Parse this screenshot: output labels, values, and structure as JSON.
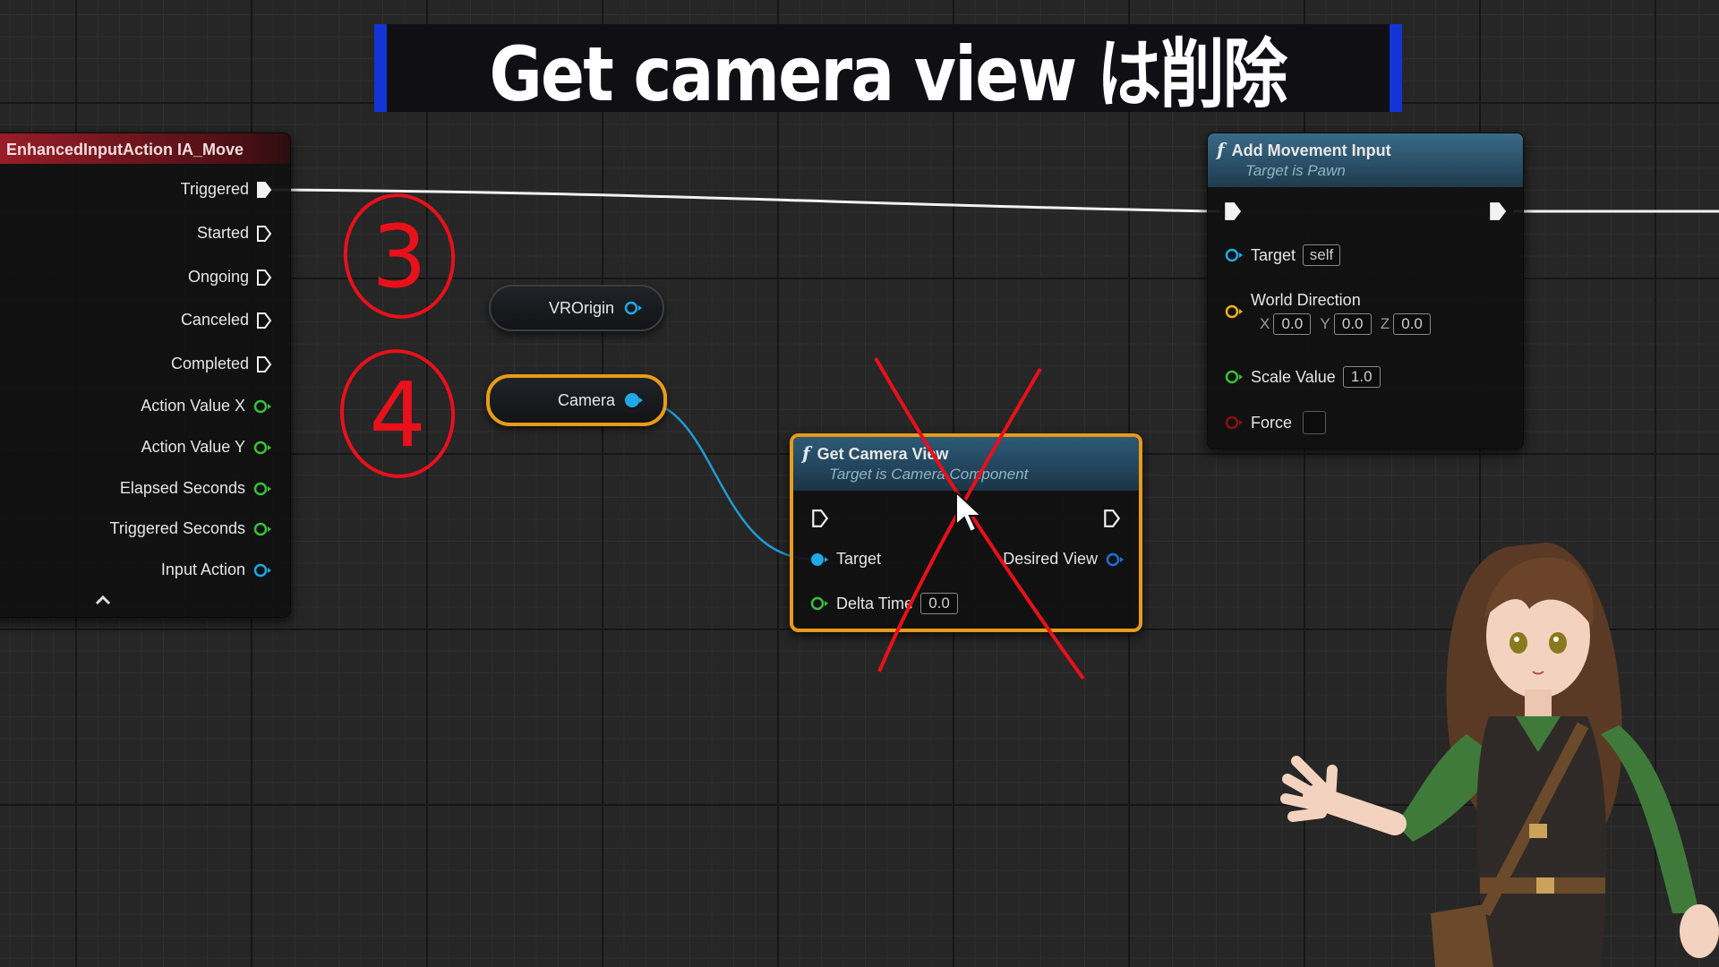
{
  "title_banner": {
    "text": "Get camera view は削除"
  },
  "event_node": {
    "title": "EnhancedInputAction IA_Move",
    "exec_pins": [
      "Triggered",
      "Started",
      "Ongoing",
      "Canceled",
      "Completed"
    ],
    "data_pins": [
      "Action Value X",
      "Action Value Y",
      "Elapsed Seconds",
      "Triggered Seconds",
      "Input Action"
    ]
  },
  "vr_origin_node": {
    "label": "VROrigin"
  },
  "camera_node": {
    "label": "Camera"
  },
  "get_camera_view_node": {
    "title": "Get Camera View",
    "subtitle": "Target is Camera Component",
    "target_label": "Target",
    "desired_view_label": "Desired View",
    "delta_time_label": "Delta Time",
    "delta_time_value": "0.0"
  },
  "add_movement_input_node": {
    "title": "Add Movement Input",
    "subtitle": "Target is Pawn",
    "target_label": "Target",
    "target_value": "self",
    "world_direction_label": "World Direction",
    "axis_x": "X",
    "x_value": "0.0",
    "axis_y": "Y",
    "y_value": "0.0",
    "axis_z": "Z",
    "z_value": "0.0",
    "scale_value_label": "Scale Value",
    "scale_value": "1.0",
    "force_label": "Force"
  },
  "annotations": {
    "mark_3": "3",
    "mark_4": "4"
  },
  "colors": {
    "exec": "#ffffff",
    "float_pin": "#39c13b",
    "object_pin": "#1fa8e8",
    "struct_pin": "#1a74d4",
    "vector_pin": "#f0b418",
    "bool_pin": "#8c1010",
    "selection": "#e79b18",
    "annotation_red": "#e8101a",
    "banner_blue": "#1335d6"
  }
}
